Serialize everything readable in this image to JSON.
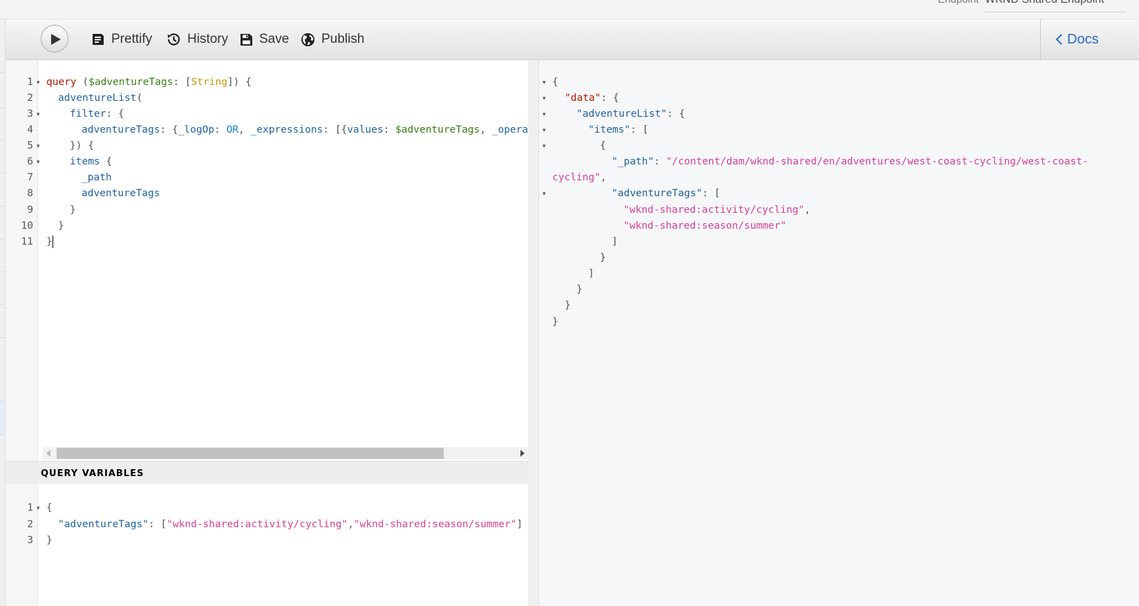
{
  "header": {
    "endpoint_label": "Endpoint",
    "endpoint_value": "WKND Shared Endpoint"
  },
  "toolbar": {
    "run_icon": "play-icon",
    "prettify_label": "Prettify",
    "history_label": "History",
    "save_label": "Save",
    "publish_label": "Publish",
    "docs_label": "Docs"
  },
  "editor": {
    "line_numbers": [
      "1",
      "2",
      "3",
      "4",
      "5",
      "6",
      "7",
      "8",
      "9",
      "10",
      "11"
    ],
    "tokens": {
      "l1_kw": "query",
      "l1_open": " (",
      "l1_var": "$adventureTags",
      "l1_colon": ": [",
      "l1_type": "String",
      "l1_close": "]) {",
      "l2_field": "adventureList",
      "l2_paren": "(",
      "l3_field": "filter",
      "l3_rest": ": {",
      "l4_field": "adventureTags",
      "l4_a": ": {",
      "l4_logop": "_logOp",
      "l4_b": ": ",
      "l4_or": "OR",
      "l4_c": ", ",
      "l4_expr": "_expressions",
      "l4_d": ": [{",
      "l4_values": "values",
      "l4_e": ": ",
      "l4_var": "$adventureTags",
      "l4_f": ", ",
      "l4_operator": "_operator",
      "l5": "}) {",
      "l6_field": "items",
      "l6_rest": " {",
      "l7_field": "_path",
      "l8_field": "adventureTags",
      "l9": "}",
      "l10": "}",
      "l11": "}"
    }
  },
  "variables": {
    "title": "QUERY VARIABLES",
    "line_numbers": [
      "1",
      "2",
      "3"
    ],
    "l1": "{",
    "key": "\"adventureTags\"",
    "sep": ": [",
    "tag1": "\"wknd-shared:activity/cycling\"",
    "comma": ",",
    "tag2": "\"wknd-shared:season/summer\"",
    "close_bracket": "]",
    "l3": "}"
  },
  "result": {
    "open": "{",
    "data_key": "\"data\"",
    "adventureList_key": "\"adventureList\"",
    "items_key": "\"items\"",
    "item_open": "{",
    "path_key": "\"_path\"",
    "path_value_a": "\"/content/dam/wknd-shared/en/adventures/west-coast-cycling/west-coast-",
    "path_value_b": "cycling\"",
    "tags_key": "\"adventureTags\"",
    "tag1": "\"wknd-shared:activity/cycling\"",
    "tag2": "\"wknd-shared:season/summer\"",
    "colon_brace": ": {",
    "colon_bracket": ": [",
    "colon_space": ": ",
    "comma": ",",
    "close_bracket": "]",
    "close_brace": "}"
  }
}
